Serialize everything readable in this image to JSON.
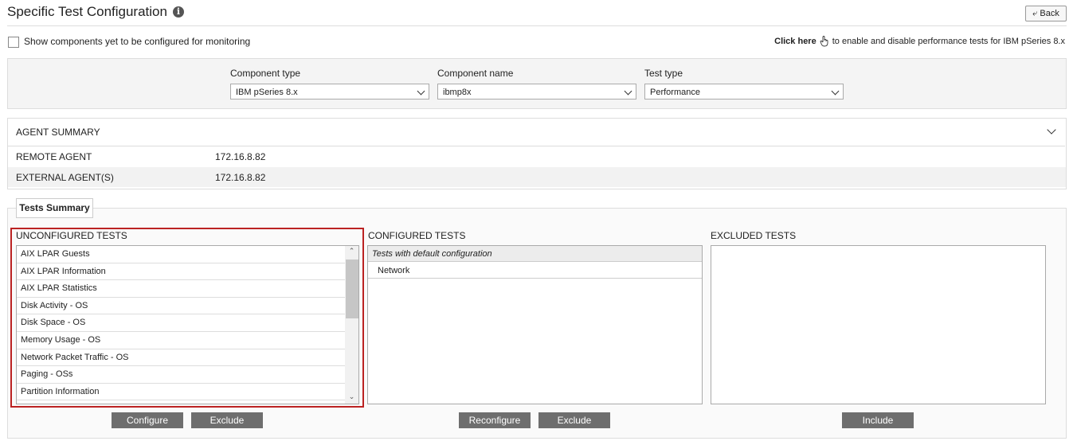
{
  "header": {
    "title": "Specific Test Configuration",
    "info_glyph": "i",
    "back_label": "Back"
  },
  "options": {
    "show_unconfigured_label": "Show components yet to be configured for monitoring",
    "show_unconfigured_checked": false,
    "click_here_label": "Click here",
    "click_here_suffix": "to enable and disable performance tests for IBM pSeries 8.x"
  },
  "filters": {
    "component_type": {
      "label": "Component type",
      "value": "IBM pSeries 8.x"
    },
    "component_name": {
      "label": "Component name",
      "value": "ibmp8x"
    },
    "test_type": {
      "label": "Test type",
      "value": "Performance"
    }
  },
  "agent_summary": {
    "title": "AGENT SUMMARY",
    "rows": [
      {
        "label": "REMOTE AGENT",
        "value": "172.16.8.82"
      },
      {
        "label": "EXTERNAL AGENT(S)",
        "value": "172.16.8.82"
      }
    ]
  },
  "tests_summary": {
    "tab_label": "Tests Summary",
    "unconfigured": {
      "label": "UNCONFIGURED TESTS",
      "items": [
        "AIX LPAR Guests",
        "AIX LPAR Information",
        "AIX LPAR Statistics",
        "Disk Activity - OS",
        "Disk Space - OS",
        "Memory Usage - OS",
        "Network Packet Traffic - OS",
        "Paging - OSs",
        "Partition Information"
      ],
      "buttons": {
        "configure": "Configure",
        "exclude": "Exclude"
      }
    },
    "configured": {
      "label": "CONFIGURED TESTS",
      "group_header": "Tests with default configuration",
      "items": [
        "Network"
      ],
      "buttons": {
        "reconfigure": "Reconfigure",
        "exclude": "Exclude"
      }
    },
    "excluded": {
      "label": "EXCLUDED TESTS",
      "items": [],
      "buttons": {
        "include": "Include"
      }
    }
  },
  "colors": {
    "highlight_border": "#b22222",
    "button_bg": "#6e6e6e",
    "panel_bg": "#f4f4f4"
  }
}
